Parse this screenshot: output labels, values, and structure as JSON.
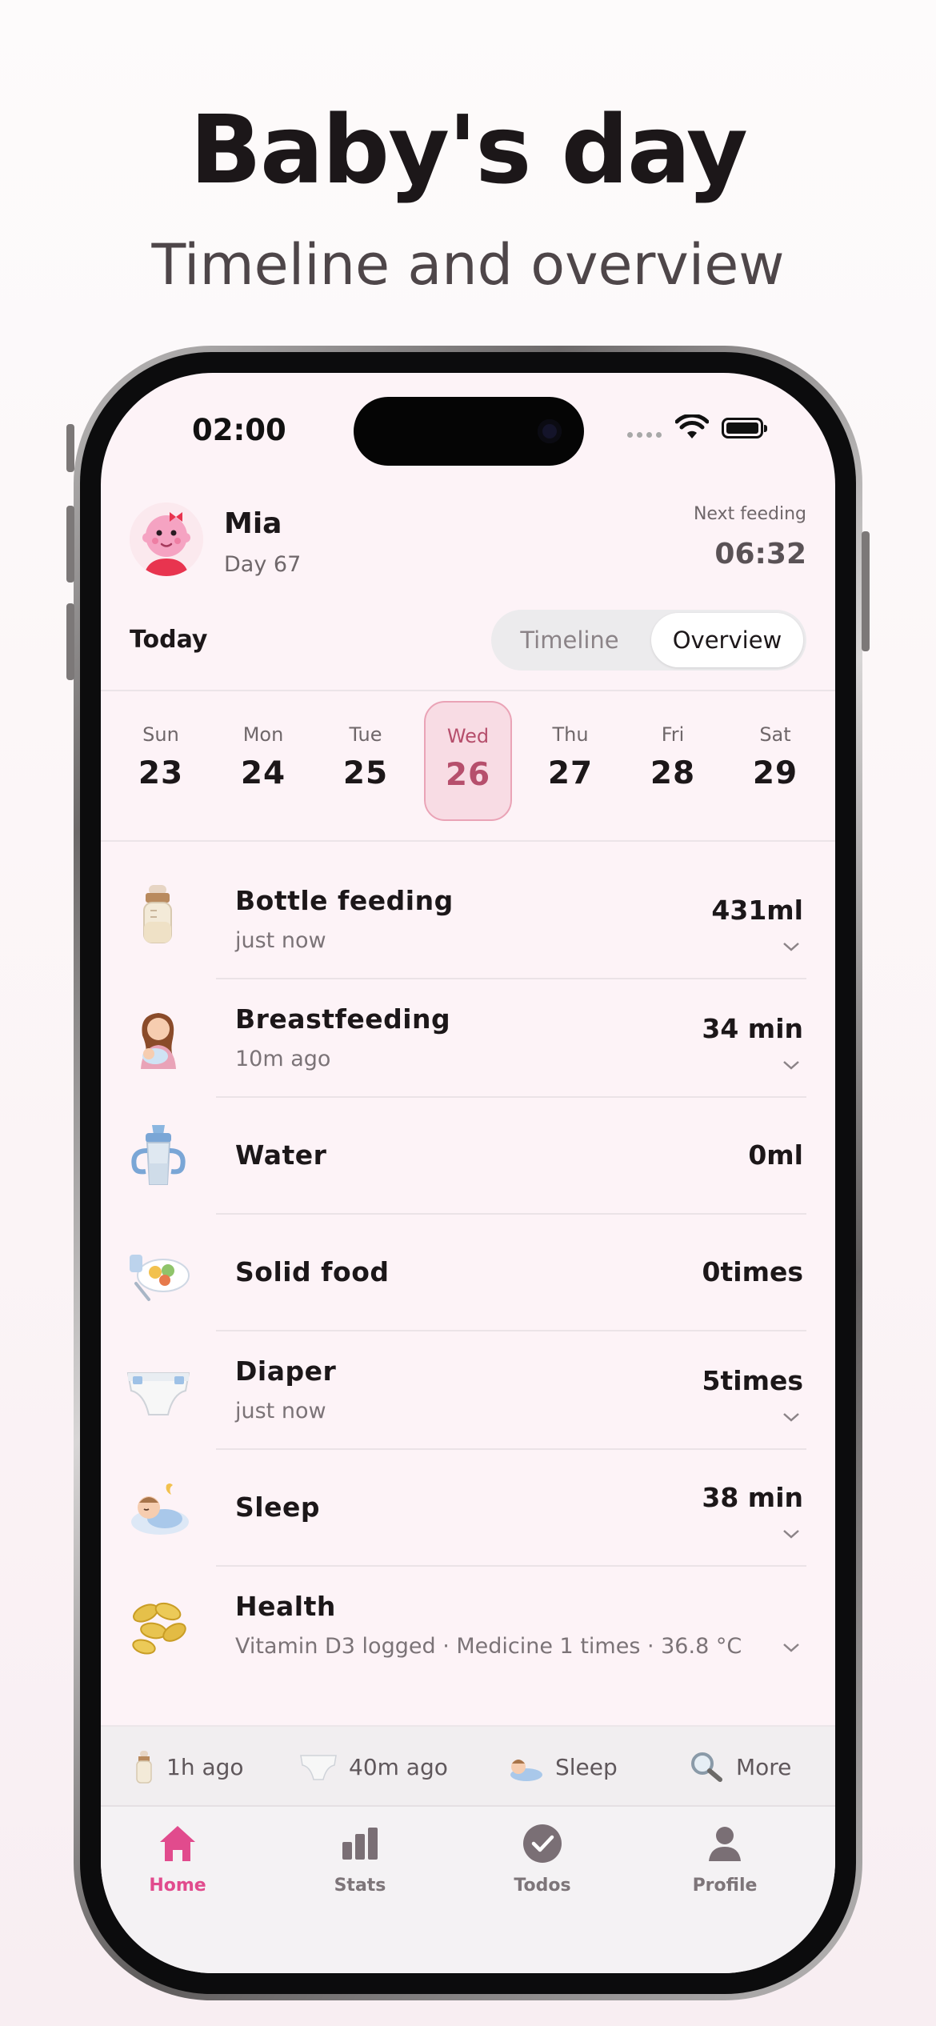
{
  "hero": {
    "title": "Baby's day",
    "subtitle": "Timeline and overview"
  },
  "status_bar": {
    "time": "02:00"
  },
  "profile": {
    "name": "Mia",
    "day": "Day 67"
  },
  "next_feeding": {
    "label": "Next feeding",
    "time": "06:32"
  },
  "view": {
    "heading": "Today",
    "segments": [
      "Timeline",
      "Overview"
    ],
    "selected": "Overview"
  },
  "week": {
    "days": [
      {
        "name": "Sun",
        "date": "23"
      },
      {
        "name": "Mon",
        "date": "24"
      },
      {
        "name": "Tue",
        "date": "25"
      },
      {
        "name": "Wed",
        "date": "26"
      },
      {
        "name": "Thu",
        "date": "27"
      },
      {
        "name": "Fri",
        "date": "28"
      },
      {
        "name": "Sat",
        "date": "29"
      }
    ],
    "selected": "Wed"
  },
  "entries": [
    {
      "title": "Bottle feeding",
      "subtitle": "just now",
      "value": "431ml",
      "icon": "baby-bottle-icon"
    },
    {
      "title": "Breastfeeding",
      "subtitle": "10m ago",
      "value": "34 min",
      "icon": "breastfeeding-icon"
    },
    {
      "title": "Water",
      "subtitle": "",
      "value": "0ml",
      "icon": "sippy-cup-icon"
    },
    {
      "title": "Solid food",
      "subtitle": "",
      "value": "0times",
      "icon": "food-plate-icon"
    },
    {
      "title": "Diaper",
      "subtitle": "just now",
      "value": "5times",
      "icon": "diaper-icon"
    },
    {
      "title": "Sleep",
      "subtitle": "",
      "value": "38 min",
      "icon": "sleeping-baby-icon"
    },
    {
      "title": "Health",
      "subtitle": "Vitamin D3 logged · Medicine 1 times · 36.8 °C",
      "value": "",
      "icon": "vitamin-capsules-icon"
    }
  ],
  "quick_actions": [
    {
      "label": "1h ago",
      "icon": "baby-bottle-icon"
    },
    {
      "label": "40m ago",
      "icon": "diaper-icon"
    },
    {
      "label": "Sleep",
      "icon": "sleeping-baby-icon"
    },
    {
      "label": "More",
      "icon": "magnifier-icon"
    }
  ],
  "tabs": [
    {
      "label": "Home",
      "icon": "home-icon",
      "active": true
    },
    {
      "label": "Stats",
      "icon": "bar-chart-icon",
      "active": false
    },
    {
      "label": "Todos",
      "icon": "check-circle-icon",
      "active": false
    },
    {
      "label": "Profile",
      "icon": "person-icon",
      "active": false
    }
  ],
  "colors": {
    "accent": "#e14b8d",
    "selected_day_bg": "#f8dce4",
    "selected_day_text": "#b64f6c",
    "screen_bg": "#fdf3f7"
  }
}
